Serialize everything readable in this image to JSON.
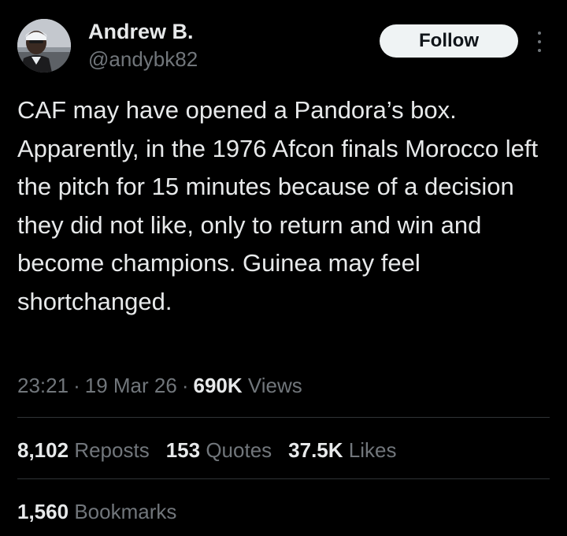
{
  "user": {
    "display_name": "Andrew B.",
    "handle": "@andybk82",
    "avatar_icon": "profile-photo"
  },
  "actions": {
    "follow_label": "Follow",
    "more_icon": "more-vertical-icon"
  },
  "tweet": {
    "text": "CAF may have opened a Pandora’s box. Apparently, in the 1976 Afcon finals Morocco left the pitch for 15 minutes because of a decision they did not like, only to return and win and become champions. Guinea may feel shortchanged.",
    "time": "23:21",
    "date": "19 Mar 26",
    "separator": "·",
    "views_count": "690K",
    "views_label": "Views"
  },
  "stats": {
    "reposts_count": "8,102",
    "reposts_label": "Reposts",
    "quotes_count": "153",
    "quotes_label": "Quotes",
    "likes_count": "37.5K",
    "likes_label": "Likes",
    "bookmarks_count": "1,560",
    "bookmarks_label": "Bookmarks"
  },
  "colors": {
    "background": "#000000",
    "primary_text": "#e7e9ea",
    "secondary_text": "#71767b",
    "divider": "#2f3336",
    "follow_bg": "#eff3f4"
  }
}
